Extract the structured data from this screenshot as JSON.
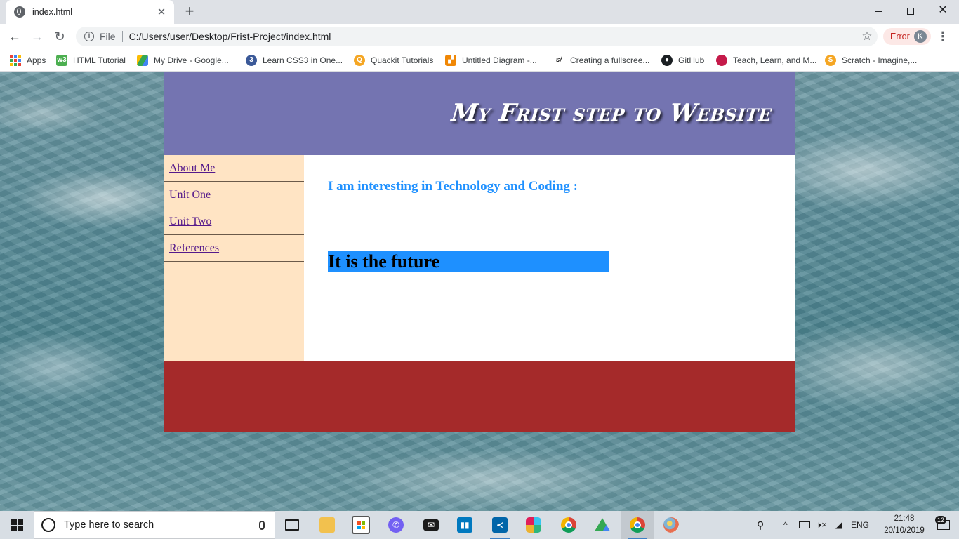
{
  "browser": {
    "tab_title": "index.html",
    "tab_close": "✕",
    "new_tab": "+",
    "file_label": "File",
    "url": "C:/Users/user/Desktop/Frist-Project/index.html",
    "error_label": "Error",
    "profile_initial": "K",
    "bookmarks": [
      {
        "label": "Apps",
        "icon": "apps-grid-icon"
      },
      {
        "label": "HTML Tutorial",
        "icon": "w3schools-icon",
        "color": "#4caf50"
      },
      {
        "label": "My Drive - Google...",
        "icon": "google-drive-icon",
        "color": "#fbbc04"
      },
      {
        "label": "Learn CSS3 in One...",
        "icon": "css-logo-icon",
        "color": "#3b5998"
      },
      {
        "label": "Quackit Tutorials",
        "icon": "quackit-icon",
        "color": "#f5a623"
      },
      {
        "label": "Untitled Diagram -...",
        "icon": "drawio-icon",
        "color": "#f08705"
      },
      {
        "label": "Creating a fullscree...",
        "icon": "sitepoint-icon",
        "color": "#222222"
      },
      {
        "label": "GitHub",
        "icon": "github-icon",
        "color": "#1b1f23"
      },
      {
        "label": "Teach, Learn, and M...",
        "icon": "raspberry-pi-icon",
        "color": "#c51a4a"
      },
      {
        "label": "Scratch - Imagine,...",
        "icon": "scratch-icon",
        "color": "#f5a623"
      }
    ]
  },
  "site": {
    "title": "My Frist step to Website",
    "nav": [
      "About Me",
      "Unit One",
      "Unit Two",
      "References"
    ],
    "heading": "I am interesting in Technology and Coding :",
    "banner": "It is the future",
    "colors": {
      "header": "#7474b1",
      "nav": "#ffe4c4",
      "footer": "#a52a2a",
      "accent": "#1e90ff"
    }
  },
  "taskbar": {
    "search_placeholder": "Type here to search",
    "language": "ENG",
    "time": "21:48",
    "date": "20/10/2019",
    "notification_count": "12"
  }
}
